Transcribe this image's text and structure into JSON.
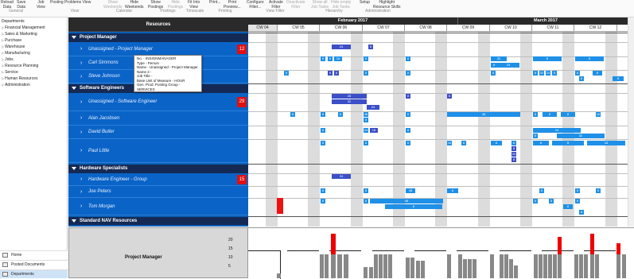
{
  "ribbon": {
    "buttons": [
      {
        "label": "Reload\nData"
      },
      {
        "label": "Save\nData"
      },
      {
        "label": "Job\nView"
      },
      {
        "label": "Posting Problems View"
      },
      {
        "label": "Show\nWeekends"
      },
      {
        "label": "Hide\nWeekends"
      },
      {
        "label": "Show\nPostings"
      },
      {
        "label": "Hide\nPostings"
      },
      {
        "label": "Fit Into\nView"
      },
      {
        "label": "Print..."
      },
      {
        "label": "Print\nPreview..."
      },
      {
        "label": "Configure\nFilter..."
      },
      {
        "label": "Activate\nFilter"
      },
      {
        "label": "Deactivate\nFilter"
      },
      {
        "label": "Show all\nJob Tasks"
      },
      {
        "label": "Hide empty\nJob Tasks"
      },
      {
        "label": "Setup"
      },
      {
        "label": "Highlight\nResource Skills"
      }
    ],
    "groups": [
      "General",
      "View",
      "Calendar",
      "Postings",
      "Timescale",
      "Printing",
      "View Filter",
      "Hierarchy",
      "Administration"
    ]
  },
  "nav": {
    "items": [
      "Departments",
      "Financial Management",
      "Sales & Marketing",
      "Purchase",
      "Warehouse",
      "Manufacturing",
      "Jobs",
      "Resource Planning",
      "Service",
      "Human Resources",
      "Administration"
    ],
    "footer": [
      "Home",
      "Posted Documents",
      "Departments"
    ]
  },
  "resources_header": "Resources",
  "groups": [
    {
      "name": "Project Manager",
      "rows": [
        {
          "name": "Unassigned - Project Manager",
          "badge": "12"
        },
        {
          "name": "Carl Simmons",
          "badge": ""
        },
        {
          "name": "Steve Johnson",
          "badge": ""
        }
      ]
    },
    {
      "name": "Software Engineers",
      "rows": [
        {
          "name": "Unassigned - Software Engineer",
          "badge": "29"
        },
        {
          "name": "Alan Jacobsen",
          "badge": ""
        },
        {
          "name": "David Butler",
          "badge": ""
        },
        {
          "name": "Paul Little",
          "badge": ""
        }
      ]
    },
    {
      "name": "Hardware Specialists",
      "rows": [
        {
          "name": "Hardware Engineer - Group",
          "badge": "15"
        },
        {
          "name": "Joe Peters",
          "badge": ""
        },
        {
          "name": "Tom Morgan",
          "badge": ""
        }
      ]
    }
  ],
  "footer_group": "Standard NAV Resources",
  "tooltip": [
    "No. - INSIGNMANAGER",
    "Type - Person",
    "Name - Unassigned - Project Manager",
    "Name 2 -",
    "Job Title -",
    "Base Unit of Measure - HOUR",
    "Gen. Prod. Posting Group - SERVICES"
  ],
  "months": [
    "February 2017",
    "March 2017"
  ],
  "weeks": [
    "CW 04",
    "CW 05",
    "CW 06",
    "CW 07",
    "CW 08",
    "CW 09",
    "CW 10",
    "CW 11",
    "CW 12"
  ],
  "bar_labels": [
    "24",
    "8",
    "8",
    "8",
    "16",
    "8",
    "8",
    "32",
    "8",
    "8",
    "8",
    "8",
    "8",
    "8",
    "24",
    "8",
    "8",
    "8",
    "8",
    "28",
    "32",
    "24",
    "8",
    "8",
    "8",
    "8",
    "8",
    "48",
    "8",
    "8",
    "8",
    "8",
    "8",
    "16",
    "8",
    "24",
    "8",
    "8",
    "32",
    "8",
    "8",
    "8",
    "16",
    "8",
    "8",
    "8",
    "8",
    "24",
    "8",
    "8",
    "8",
    "16",
    "24",
    "8",
    "8",
    "48",
    "8",
    "8",
    "8",
    "8",
    "8",
    "8",
    "8",
    "8"
  ],
  "chart": {
    "title": "Project Manager",
    "y_ticks": [
      "20",
      "15",
      "10",
      "5"
    ],
    "colors": {
      "accent": "#0a64c8",
      "overload": "#e00000",
      "header": "#2a2a2a"
    }
  }
}
